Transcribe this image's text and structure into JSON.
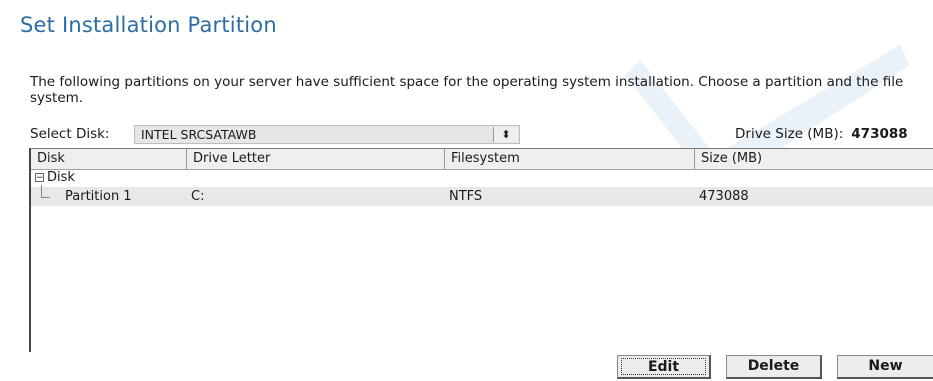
{
  "page": {
    "title": "Set Installation Partition",
    "intro": "The following partitions on your server have sufficient space for the operating system installation. Choose a partition and the file system."
  },
  "disk_select": {
    "label": "Select Disk:",
    "value": "INTEL SRCSATAWB",
    "spinner_glyph": "⬍"
  },
  "drive_size": {
    "label": "Drive Size (MB):",
    "value": "473088"
  },
  "table": {
    "columns": [
      "Disk",
      "Drive Letter",
      "Filesystem",
      "Size (MB)"
    ],
    "tree": {
      "expander_glyph": "−",
      "disk_node_label": "Disk",
      "rows": [
        {
          "disk": "Partition 1",
          "drive_letter": "C:",
          "filesystem": "NTFS",
          "size_mb": "473088"
        }
      ]
    }
  },
  "buttons": {
    "edit": "Edit",
    "delete": "Delete",
    "new": "New"
  },
  "colors": {
    "title": "#2e6da4",
    "watermark": "#dce8f5",
    "selected_row": "#e8e8e8"
  },
  "icons": {
    "background": "checkmark-watermark-icon",
    "expander": "tree-collapse-icon",
    "spinner": "updown-arrows-icon"
  }
}
